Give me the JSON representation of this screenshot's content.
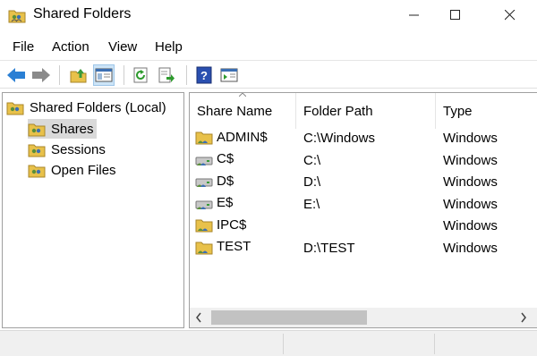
{
  "window": {
    "title": "Shared Folders"
  },
  "menu": [
    "File",
    "Action",
    "View",
    "Help"
  ],
  "toolbar": {
    "buttons": [
      "back-arrow-icon",
      "forward-arrow-icon",
      "up-folder-icon",
      "show-tree-icon",
      "refresh-icon",
      "export-list-icon",
      "help-icon",
      "action-pane-icon"
    ]
  },
  "tree": {
    "root": "Shared Folders (Local)",
    "items": [
      "Shares",
      "Sessions",
      "Open Files"
    ],
    "selected": "Shares"
  },
  "columns": [
    "Share Name",
    "Folder Path",
    "Type"
  ],
  "shares": [
    {
      "name": "ADMIN$",
      "path": "C:\\Windows",
      "type": "Windows",
      "icon": "share-folder-icon"
    },
    {
      "name": "C$",
      "path": "C:\\",
      "type": "Windows",
      "icon": "share-drive-icon"
    },
    {
      "name": "D$",
      "path": "D:\\",
      "type": "Windows",
      "icon": "share-drive-icon"
    },
    {
      "name": "E$",
      "path": "E:\\",
      "type": "Windows",
      "icon": "share-drive-icon"
    },
    {
      "name": "IPC$",
      "path": "",
      "type": "Windows",
      "icon": "share-folder-icon"
    },
    {
      "name": "TEST",
      "path": "D:\\TEST",
      "type": "Windows",
      "icon": "share-folder-icon"
    }
  ],
  "colors": {
    "accent": "#2a7fd4",
    "folder": "#e8c14a",
    "selection": "#d9d9d9",
    "statusbar": "#f0f0f0"
  }
}
